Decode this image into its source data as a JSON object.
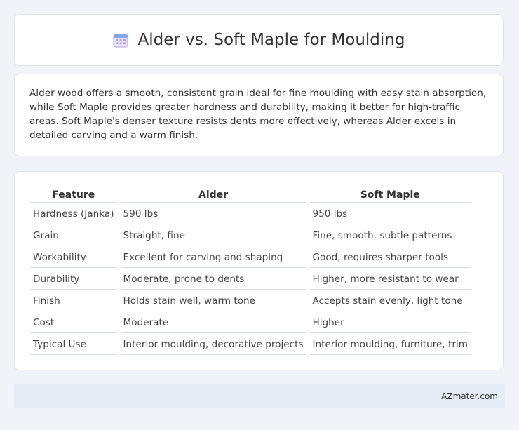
{
  "header": {
    "icon": "calendar-icon",
    "title": "Alder vs. Soft Maple for Moulding"
  },
  "summary": {
    "text": "Alder wood offers a smooth, consistent grain ideal for fine moulding with easy stain absorption, while Soft Maple provides greater hardness and durability, making it better for high-traffic areas. Soft Maple's denser texture resists dents more effectively, whereas Alder excels in detailed carving and a warm finish."
  },
  "table": {
    "headers": [
      "Feature",
      "Alder",
      "Soft Maple"
    ],
    "rows": [
      [
        "Hardness (Janka)",
        "590 lbs",
        "950 lbs"
      ],
      [
        "Grain",
        "Straight, fine",
        "Fine, smooth, subtle patterns"
      ],
      [
        "Workability",
        "Excellent for carving and shaping",
        "Good, requires sharper tools"
      ],
      [
        "Durability",
        "Moderate, prone to dents",
        "Higher, more resistant to wear"
      ],
      [
        "Finish",
        "Holds stain well, warm tone",
        "Accepts stain evenly, light tone"
      ],
      [
        "Cost",
        "Moderate",
        "Higher"
      ],
      [
        "Typical Use",
        "Interior moulding, decorative projects",
        "Interior moulding, furniture, trim"
      ]
    ]
  },
  "footer": {
    "text": "AZmater.com"
  }
}
